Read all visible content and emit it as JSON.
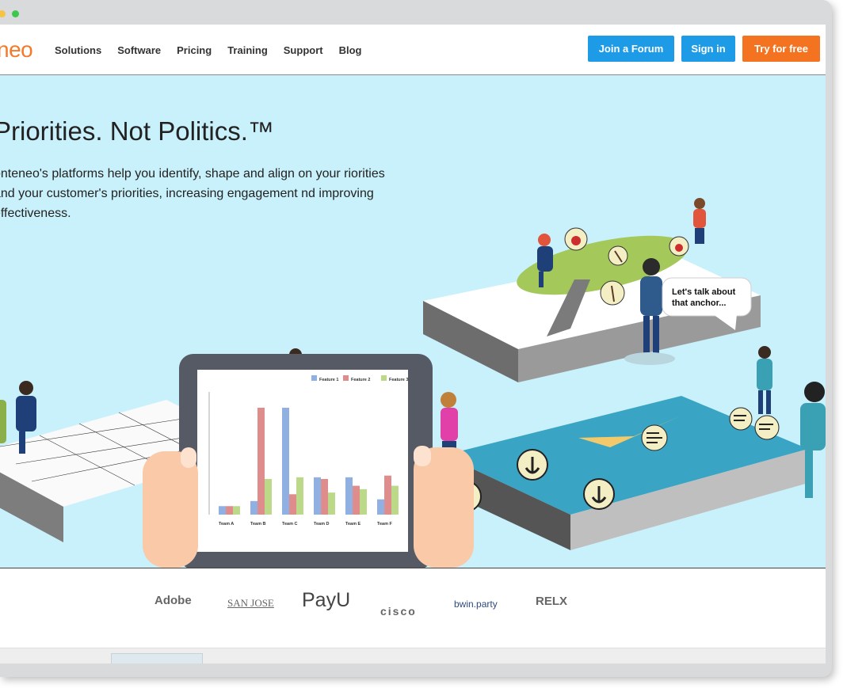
{
  "nav": {
    "logo": "neo",
    "menu": [
      "Solutions",
      "Software",
      "Pricing",
      "Training",
      "Support",
      "Blog"
    ],
    "buttons": {
      "forum": "Join a Forum",
      "signin": "Sign in",
      "try": "Try for free"
    }
  },
  "hero": {
    "title": "Priorities. Not Politics.™",
    "body": "onteneo's platforms help you identify, shape and align on your riorities and your customer's priorities, increasing engagement nd improving effectiveness.",
    "speech": [
      "Let's talk about",
      "that anchor..."
    ]
  },
  "tablet_chart": {
    "legend": [
      "Feature 1",
      "Feature 2",
      "Feature 3"
    ],
    "categories": [
      "Team A",
      "Team B",
      "Team C",
      "Team D",
      "Team E",
      "Team F"
    ],
    "colors": {
      "f1": "#8fb0e0",
      "f2": "#df8c8c",
      "f3": "#bcd98a"
    }
  },
  "chart_data": {
    "type": "bar",
    "categories": [
      "Team A",
      "Team B",
      "Team C",
      "Team D",
      "Team E",
      "Team F"
    ],
    "series": [
      {
        "name": "Feature 1",
        "values": [
          5,
          8,
          63,
          22,
          22,
          9
        ]
      },
      {
        "name": "Feature 2",
        "values": [
          5,
          63,
          12,
          21,
          17,
          23
        ]
      },
      {
        "name": "Feature 3",
        "values": [
          5,
          21,
          22,
          13,
          15,
          17
        ]
      }
    ],
    "ylim": [
      0,
      70
    ]
  },
  "logos": [
    "Adobe",
    "SAN JOSE",
    "PayU",
    "cisco",
    "bwin.party",
    "RELX"
  ],
  "colors": {
    "accent": "#1e9be6",
    "cta": "#f47321",
    "hero_bg": "#c9f1fb",
    "logo": "#f47a2a"
  }
}
